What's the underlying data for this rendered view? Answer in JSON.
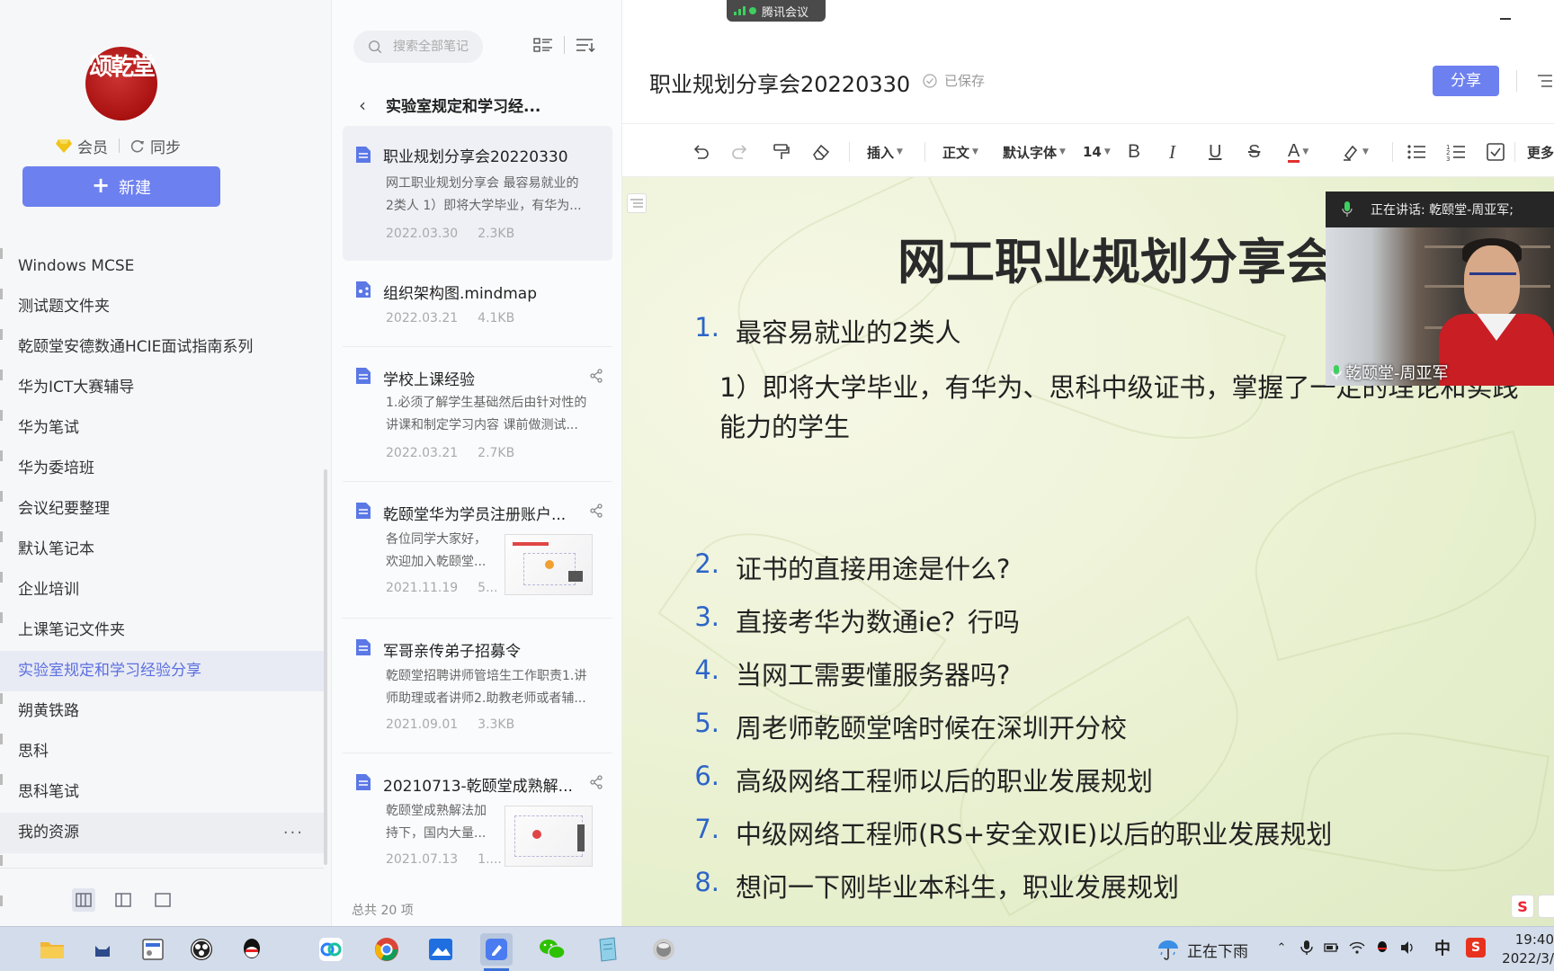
{
  "meeting": {
    "app_label": "腾讯会议"
  },
  "sidebar": {
    "logo_text": "颂乾堂",
    "member_label": "会员",
    "sync_label": "同步",
    "new_button_label": "新建",
    "folders": [
      {
        "label": "Windows MCSE"
      },
      {
        "label": "测试题文件夹"
      },
      {
        "label": "乾颐堂安德数通HCIE面试指南系列"
      },
      {
        "label": "华为ICT大赛辅导"
      },
      {
        "label": "华为笔试"
      },
      {
        "label": "华为委培班"
      },
      {
        "label": "会议纪要整理"
      },
      {
        "label": "默认笔记本"
      },
      {
        "label": "企业培训"
      },
      {
        "label": "上课笔记文件夹"
      },
      {
        "label": "实验室规定和学习经验分享"
      },
      {
        "label": "朔黄铁路"
      },
      {
        "label": "思科"
      },
      {
        "label": "思科笔试"
      },
      {
        "label": "我的资源"
      }
    ],
    "active_folder_index": 10,
    "more_label": "···"
  },
  "notelist": {
    "search_placeholder": "搜索全部笔记",
    "folder_title": "实验室规定和学习经...",
    "notes": [
      {
        "title": "职业规划分享会20220330",
        "snippet1": "网工职业规划分享会 最容易就业的",
        "snippet2": "2类人 1）即将大学毕业，有华为...",
        "date": "2022.03.30",
        "size": "2.3KB"
      },
      {
        "title": "组织架构图.mindmap",
        "date": "2022.03.21",
        "size": "4.1KB"
      },
      {
        "title": "学校上课经验",
        "snippet1": "1.必须了解学生基础然后由针对性的",
        "snippet2": "讲课和制定学习内容 课前做测试...",
        "date": "2022.03.21",
        "size": "2.7KB"
      },
      {
        "title": "乾颐堂华为学员注册账户...",
        "snippet1": "各位同学大家好，",
        "snippet2": "欢迎加入乾颐堂...",
        "date": "2021.11.19",
        "size": "5..."
      },
      {
        "title": "军哥亲传弟子招募令",
        "snippet1": "乾颐堂招聘讲师管培生工作职责1.讲",
        "snippet2": "师助理或者讲师2.助教老师或者辅...",
        "date": "2021.09.01",
        "size": "3.3KB"
      },
      {
        "title": "20210713-乾颐堂成熟解...",
        "snippet1": "乾颐堂成熟解法加",
        "snippet2": "持下，国内大量...",
        "date": "2021.07.13",
        "size": "1...."
      }
    ],
    "footer": "总共 20 项"
  },
  "editor": {
    "doc_title": "职业规划分享会20220330",
    "saved_label": "已保存",
    "share_label": "分享",
    "toolbar": {
      "insert": "插入",
      "paragraph": "正文",
      "font": "默认字体",
      "size": "14",
      "bold": "B",
      "italic": "I",
      "underline": "U",
      "strike": "S",
      "color": "A",
      "more": "更多"
    },
    "slide_title": "网工职业规划分享会",
    "items": [
      {
        "num": "1.",
        "text": "最容易就业的2类人"
      },
      {
        "num": "2.",
        "text": "证书的直接用途是什么?"
      },
      {
        "num": "3.",
        "text": "直接考华为数通ie？行吗"
      },
      {
        "num": "4.",
        "text": "当网工需要懂服务器吗?"
      },
      {
        "num": "5.",
        "text": "周老师乾颐堂啥时候在深圳开分校"
      },
      {
        "num": "6.",
        "text": "高级网络工程师以后的职业发展规划"
      },
      {
        "num": "7.",
        "text": "中级网络工程师(RS+安全双IE)以后的职业发展规划"
      },
      {
        "num": "8.",
        "text": "想问一下刚毕业本科生，职业发展规划"
      }
    ],
    "paragraph": "1）即将大学毕业，有华为、思科中级证书，掌握了一定的理论和实践能力的学生"
  },
  "video": {
    "speaking_label": "正在讲话: 乾颐堂-周亚军;",
    "name_tag": "乾颐堂-周亚军"
  },
  "taskbar": {
    "weather": "正在下雨",
    "ime": "中",
    "sogou": "S",
    "time": "19:40",
    "date": "2022/3/"
  },
  "colors": {
    "accent": "#6d80ef",
    "number_blue": "#2d64c8",
    "logo_red": "#a11111",
    "taskbar": "#d3dcea"
  }
}
